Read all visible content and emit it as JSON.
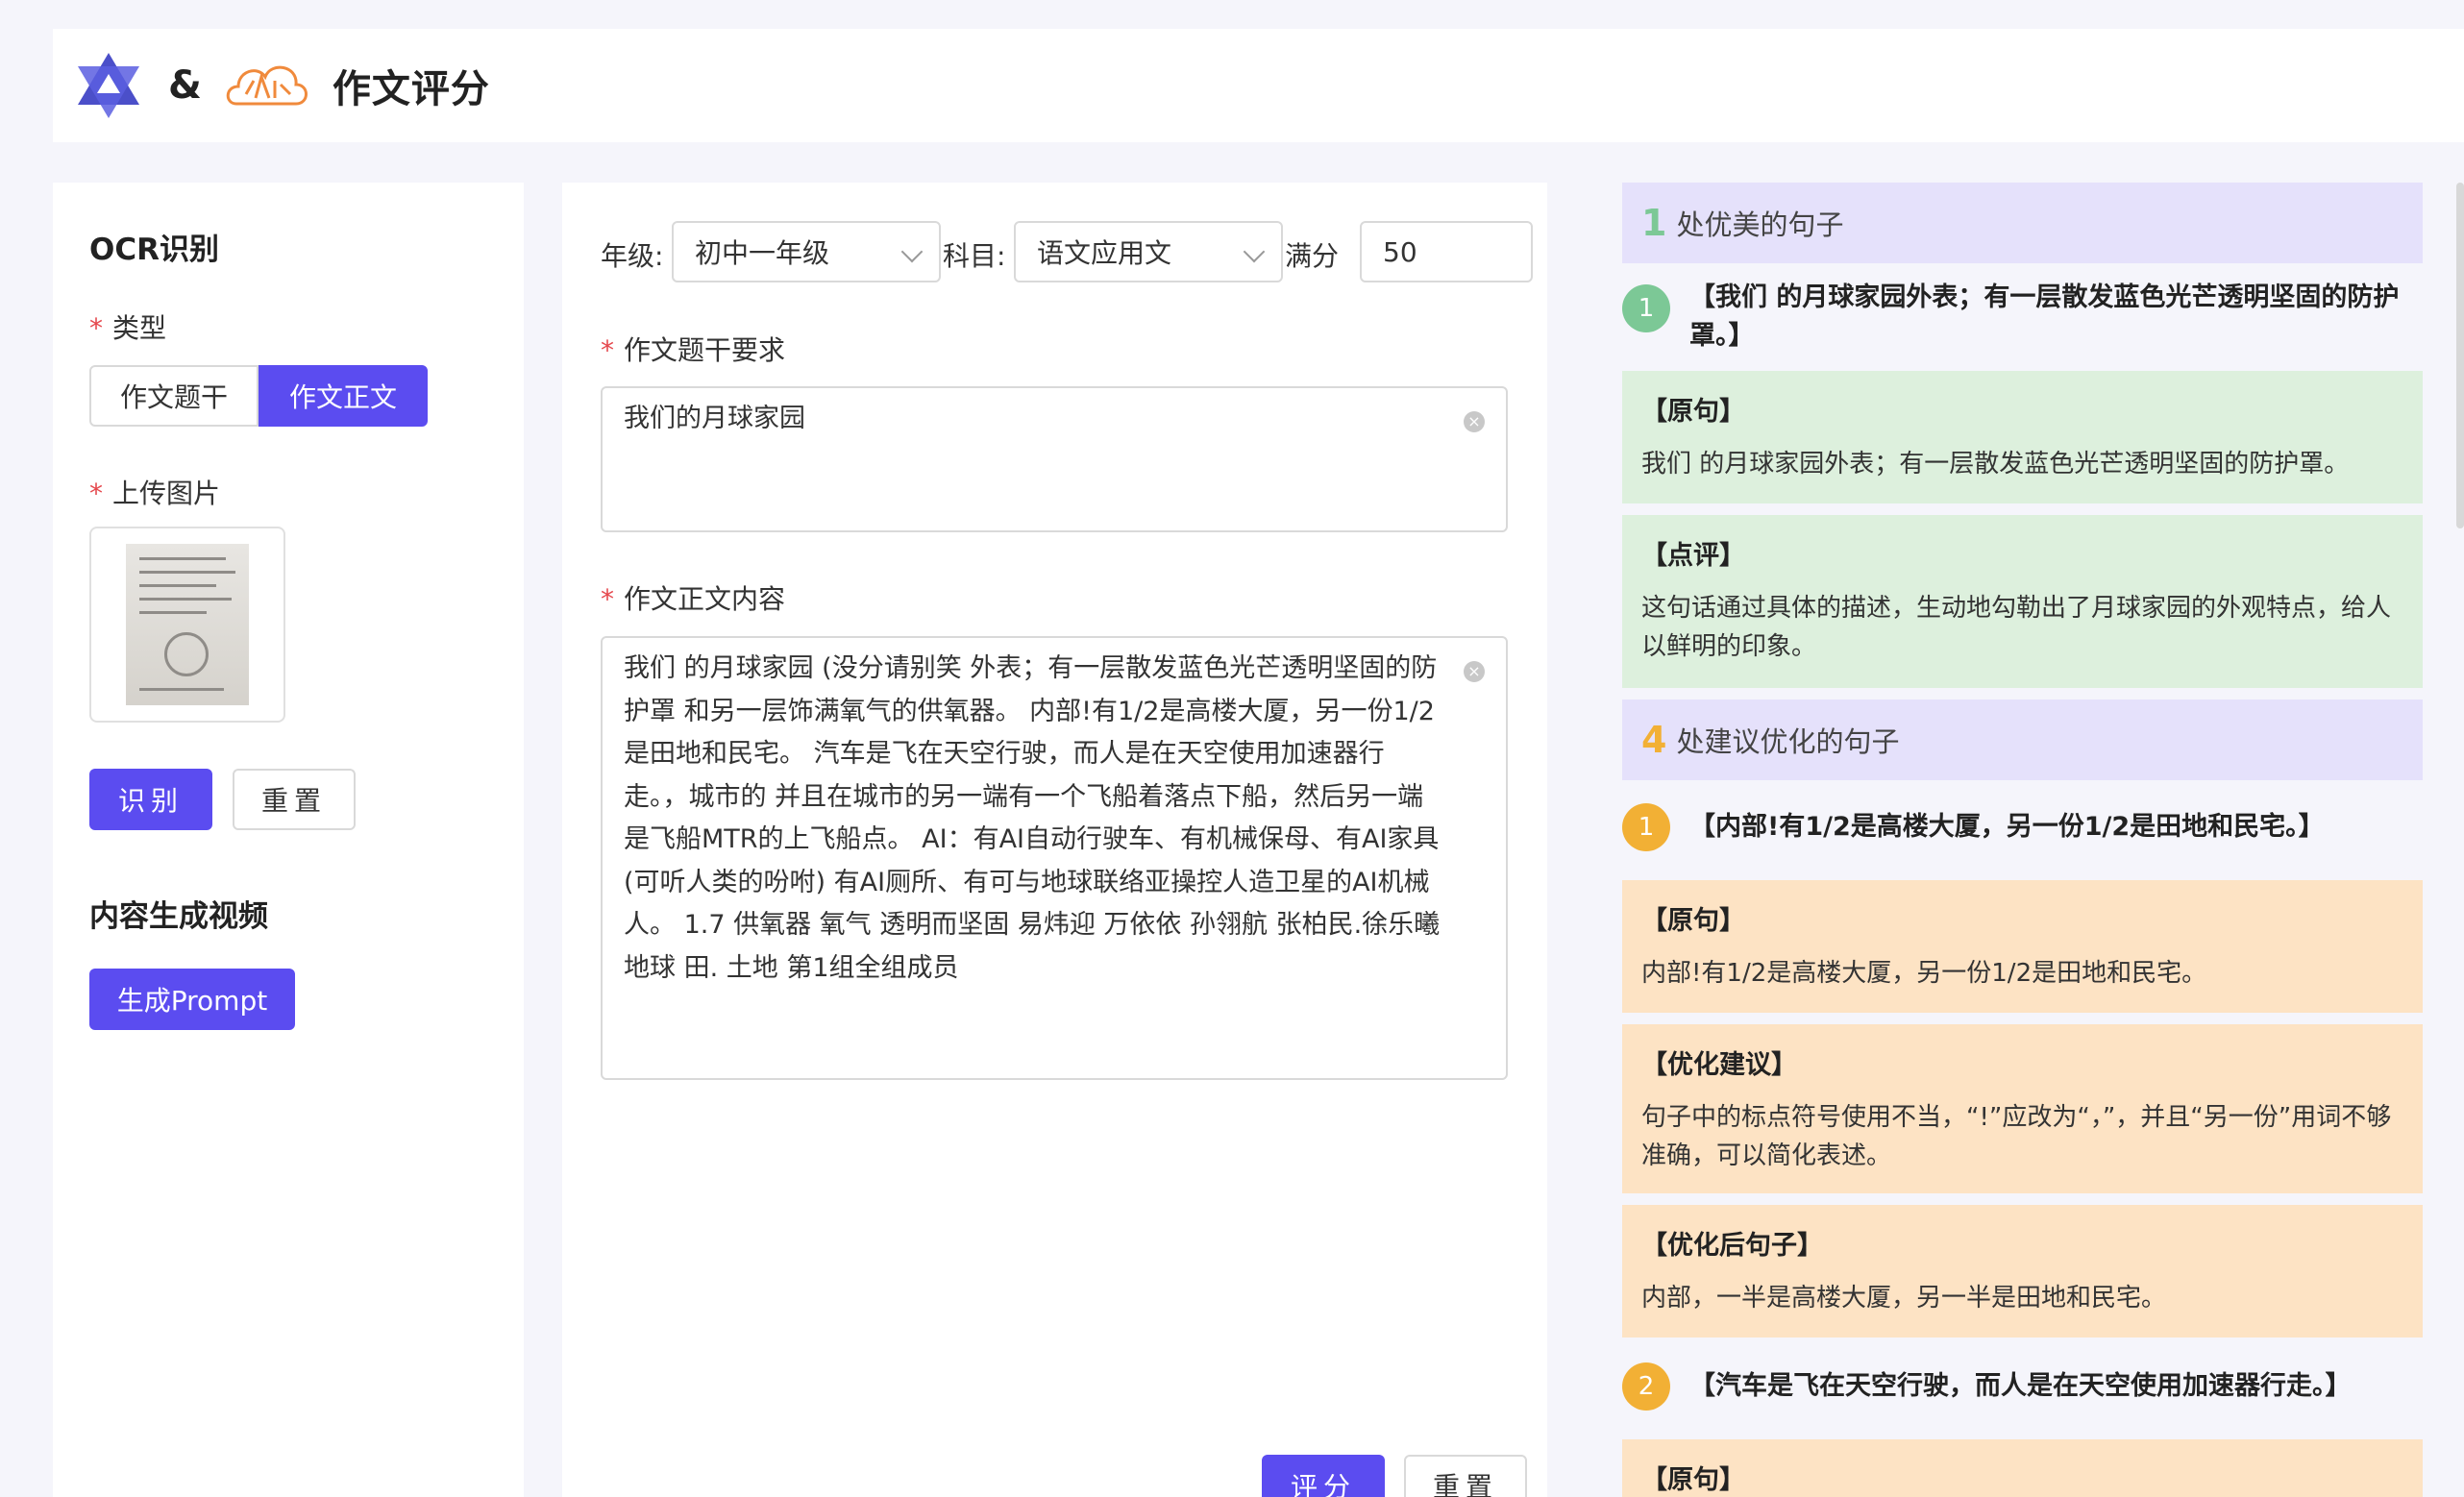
{
  "header": {
    "amp": "&",
    "title": "作文评分",
    "logo_b_text": "小牛云"
  },
  "left": {
    "ocr_title": "OCR识别",
    "type_label": "类型",
    "type_options": [
      "作文题干",
      "作文正文"
    ],
    "type_selected": "作文正文",
    "upload_label": "上传图片",
    "recognize_btn": "识别",
    "reset_btn": "重置",
    "video_title": "内容生成视频",
    "prompt_btn": "生成Prompt"
  },
  "mid": {
    "grade_label": "年级:",
    "grade_value": "初中一年级",
    "subject_label": "科目:",
    "subject_value": "语文应用文",
    "score_label": "满分",
    "score_value": "50",
    "topic_label": "作文题干要求",
    "topic_value": "我们的月球家园",
    "content_label": "作文正文内容",
    "content_value": "我们 的月球家园 (没分请别笑 外表；有一层散发蓝色光芒透明坚固的防护罩 和另一层饰满氧气的供氧器。 内部!有1/2是高楼大厦，另一份1/2是田地和民宅。 汽车是飞在天空行驶，而人是在天空使用加速器行走。，城市的 并且在城市的另一端有一个飞船着落点下船，然后另一端是飞船MTR的上飞船点。 AI：有AI自动行驶车、有机械保母、有AI家具(可听人类的吩咐) 有AI厕所、有可与地球联络亚操控人造卫星的AI机械人。 1.7 供氧器 氧气 透明而坚固 易炜迎 万依依 孙翎航 张柏民.徐乐曦 地球 田. 土地 第1组全组成员",
    "score_btn": "评分",
    "reset_btn": "重置"
  },
  "right": {
    "good_count": "1",
    "good_title": "处优美的句子",
    "good_items": [
      {
        "index": "1",
        "sentence": "【我们 的月球家园外表；有一层散发蓝色光芒透明坚固的防护罩。】",
        "original_h": "【原句】",
        "original": "我们 的月球家园外表；有一层散发蓝色光芒透明坚固的防护罩。",
        "comment_h": "【点评】",
        "comment": "这句话通过具体的描述，生动地勾勒出了月球家园的外观特点，给人以鲜明的印象。"
      }
    ],
    "improve_count": "4",
    "improve_title": "处建议优化的句子",
    "improve_items": [
      {
        "index": "1",
        "sentence": "【内部!有1/2是高楼大厦，另一份1/2是田地和民宅。】",
        "original_h": "【原句】",
        "original": "内部!有1/2是高楼大厦，另一份1/2是田地和民宅。",
        "suggest_h": "【优化建议】",
        "suggest": "句子中的标点符号使用不当，“!”应改为“，”，并且“另一份”用词不够准确，可以简化表述。",
        "optimized_h": "【优化后句子】",
        "optimized": "内部，一半是高楼大厦，另一半是田地和民宅。"
      },
      {
        "index": "2",
        "sentence": "【汽车是飞在天空行驶，而人是在天空使用加速器行走。】",
        "original_h": "【原句】"
      }
    ]
  },
  "colors": {
    "accent": "#5b4cf0",
    "good": "#7cc896",
    "good_bg": "#ddf0dd",
    "improve": "#f2b035",
    "improve_bg": "#fde3c4",
    "section_bg": "#e5e1fb"
  }
}
